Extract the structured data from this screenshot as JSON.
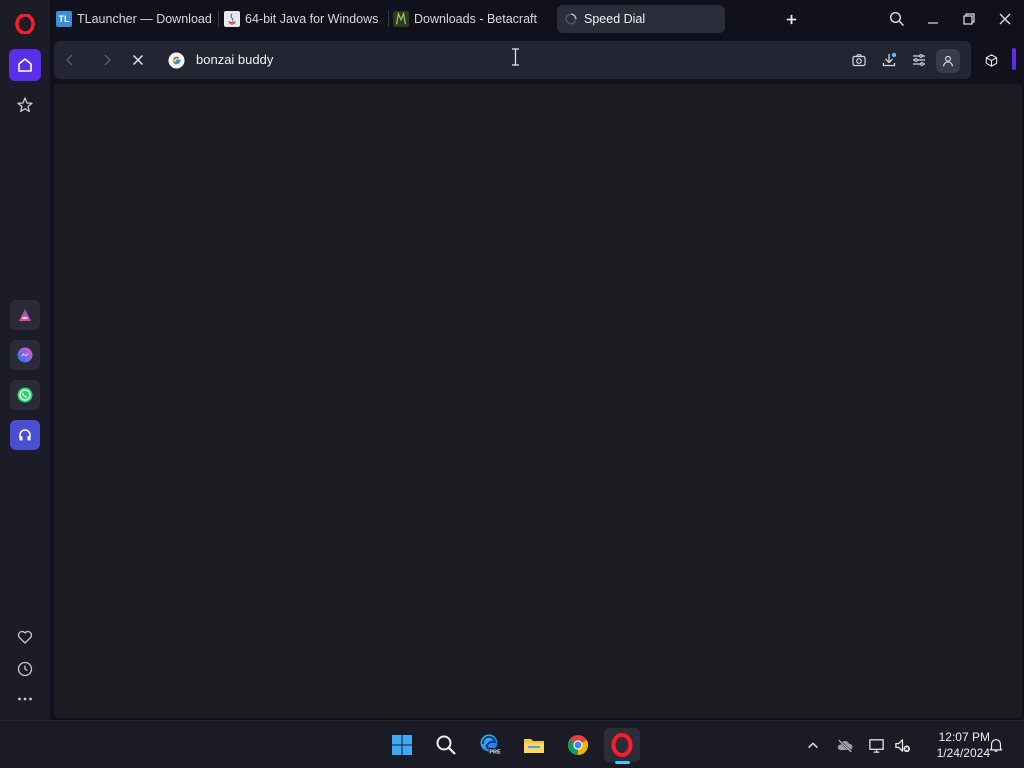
{
  "sidebar": {
    "logo_icon": "opera-logo-icon",
    "home_icon": "home-icon",
    "bookmarks_icon": "star-icon",
    "apps": [
      "aria-icon",
      "messenger-icon",
      "whatsapp-icon",
      "music-player-icon"
    ],
    "bottom": [
      "heart-icon",
      "history-clock-icon",
      "more-dots-icon"
    ]
  },
  "tabs": [
    {
      "label": "TLauncher — Download M",
      "favicon_text": "TL",
      "favicon_color": "#3a8fd6"
    },
    {
      "label": "64-bit Java for Windows",
      "favicon_text": "",
      "favicon_color": "#e8e8ee"
    },
    {
      "label": "Downloads - Betacraft",
      "favicon_text": "",
      "favicon_color": "#7da04a"
    },
    {
      "label": "Speed Dial",
      "favicon_text": "",
      "favicon_color": "#9a9aa6"
    }
  ],
  "addressbar": {
    "value": "bonzai buddy",
    "search_engine_icon": "google-g-icon"
  },
  "taskbar": {
    "apps": [
      "windows-start-icon",
      "search-icon",
      "edge-preview-icon",
      "file-explorer-icon",
      "chrome-icon",
      "opera-icon"
    ],
    "edge_badge": "PRE",
    "time": "12:07 PM",
    "date": "1/24/2024"
  },
  "colors": {
    "accent": "#5b2ee8",
    "background": "#10111c",
    "content": "#1a1b21"
  }
}
